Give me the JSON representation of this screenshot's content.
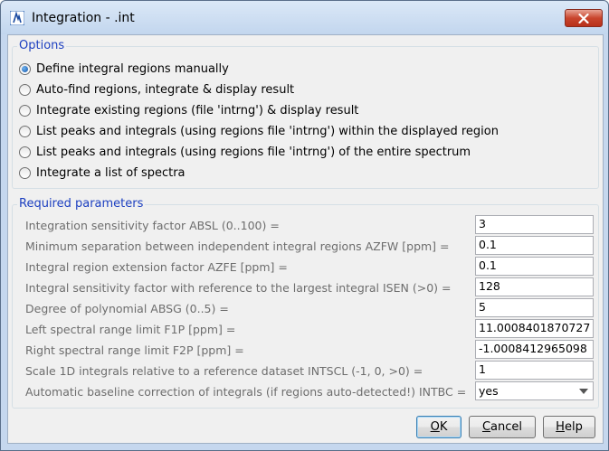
{
  "window": {
    "title": "Integration - .int",
    "close_icon": "close-x-icon",
    "app_icon": "topspin-app-icon"
  },
  "options": {
    "legend": "Options",
    "items": [
      {
        "label": "Define integral regions manually",
        "selected": true
      },
      {
        "label": "Auto-find regions, integrate & display result",
        "selected": false
      },
      {
        "label": "Integrate existing regions (file 'intrng') & display result",
        "selected": false
      },
      {
        "label": "List peaks and integrals (using regions file 'intrng') within the displayed region",
        "selected": false
      },
      {
        "label": "List peaks and integrals (using regions file 'intrng') of the entire spectrum",
        "selected": false
      },
      {
        "label": "Integrate a list of spectra",
        "selected": false
      }
    ]
  },
  "parameters": {
    "legend": "Required parameters",
    "items": [
      {
        "label": "Integration sensitivity factor ABSL (0..100) =",
        "value": "3"
      },
      {
        "label": "Minimum separation between independent integral regions AZFW [ppm] =",
        "value": "0.1"
      },
      {
        "label": "Integral region extension factor AZFE [ppm] =",
        "value": "0.1"
      },
      {
        "label": "Integral sensitivity factor with reference to the largest integral ISEN (>0) =",
        "value": "128"
      },
      {
        "label": "Degree of polynomial ABSG (0..5) =",
        "value": "5"
      },
      {
        "label": "Left spectral range limit F1P [ppm] =",
        "value": "11.0008401870727"
      },
      {
        "label": "Right spectral range limit F2P [ppm] =",
        "value": "-1.0008412965098"
      },
      {
        "label": "Scale 1D integrals relative to a reference dataset INTSCL (-1, 0, >0) =",
        "value": "1"
      }
    ],
    "baseline": {
      "label": "Automatic baseline correction of integrals (if regions auto-detected!) INTBC =",
      "value": "yes"
    }
  },
  "buttons": {
    "ok": {
      "mnemonic": "O",
      "rest": "K"
    },
    "cancel": {
      "mnemonic": "C",
      "rest": "ancel"
    },
    "help": {
      "mnemonic": "H",
      "rest": "elp"
    }
  }
}
